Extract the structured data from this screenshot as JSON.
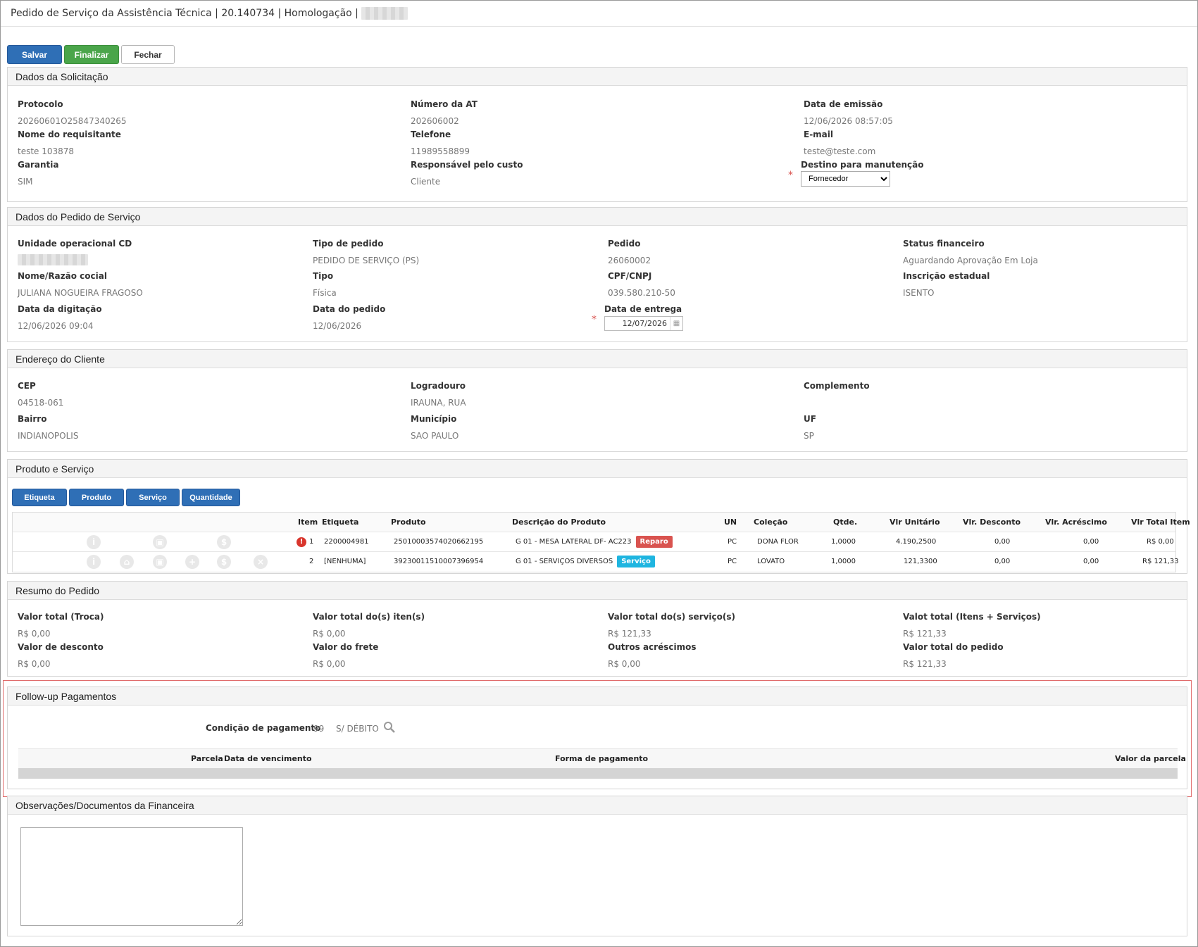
{
  "window": {
    "title": "Pedido de Serviço da Assistência Técnica | 20.140734 | Homologação |"
  },
  "toolbar": {
    "save": "Salvar",
    "finish": "Finalizar",
    "close": "Fechar"
  },
  "solicitacao": {
    "title": "Dados da Solicitação",
    "protocolo_label": "Protocolo",
    "protocolo": "20260601O25847340265",
    "numero_at_label": "Número da AT",
    "numero_at": "202606002",
    "data_emissao_label": "Data de emissão",
    "data_emissao": "12/06/2026 08:57:05",
    "requisitante_label": "Nome do requisitante",
    "requisitante": "teste 103878",
    "telefone_label": "Telefone",
    "telefone": "11989558899",
    "email_label": "E-mail",
    "email": "teste@teste.com",
    "garantia_label": "Garantia",
    "garantia": "SIM",
    "responsavel_label": "Responsável pelo custo",
    "responsavel": "Cliente",
    "destino_label": "Destino para manutenção",
    "destino": "Fornecedor"
  },
  "pedido": {
    "title": "Dados do Pedido de Serviço",
    "unidade_label": "Unidade operacional CD",
    "tipo_pedido_label": "Tipo de pedido",
    "tipo_pedido": "PEDIDO DE SERVIÇO (PS)",
    "pedido_label": "Pedido",
    "pedido": "26060002",
    "status_label": "Status financeiro",
    "status": "Aguardando Aprovação Em Loja",
    "nome_label": "Nome/Razão cocial",
    "nome": "JULIANA NOGUEIRA FRAGOSO",
    "tipo_label": "Tipo",
    "tipo": "Física",
    "cpf_label": "CPF/CNPJ",
    "cpf": "039.580.210-50",
    "ie_label": "Inscrição estadual",
    "ie": "ISENTO",
    "digitacao_label": "Data da digitação",
    "digitacao": "12/06/2026 09:04",
    "data_pedido_label": "Data do pedido",
    "data_pedido": "12/06/2026",
    "entrega_label": "Data de entrega",
    "entrega": "12/07/2026"
  },
  "endereco": {
    "title": "Endereço do Cliente",
    "cep_label": "CEP",
    "cep": "04518-061",
    "logradouro_label": "Logradouro",
    "logradouro": "IRAUNA, RUA",
    "complemento_label": "Complemento",
    "bairro_label": "Bairro",
    "bairro": "INDIANOPOLIS",
    "municipio_label": "Município",
    "municipio": "SAO PAULO",
    "uf_label": "UF",
    "uf": "SP"
  },
  "produtos": {
    "title": "Produto e Serviço",
    "buttons": [
      "Etiqueta",
      "Produto",
      "Serviço",
      "Quantidade"
    ],
    "columns": {
      "item": "Item",
      "etiqueta": "Etiqueta",
      "produto": "Produto",
      "descricao": "Descrição do Produto",
      "un": "UN",
      "colecao": "Coleção",
      "qtde": "Qtde.",
      "unitario": "Vlr Unitário",
      "desconto": "Vlr. Desconto",
      "acrescimo": "Vlr. Acréscimo",
      "total": "Vlr Total Item"
    },
    "rows": [
      {
        "item": "1",
        "etiqueta": "2200004981",
        "produto": "25010003574020662195",
        "descricao": "G 01 - MESA LATERAL DF- AC223",
        "badge": "Reparo",
        "un": "PC",
        "colecao": "DONA FLOR",
        "qtde": "1,0000",
        "unitario": "4.190,2500",
        "desconto": "0,00",
        "acrescimo": "0,00",
        "total": "R$ 0,00"
      },
      {
        "item": "2",
        "etiqueta": "[NENHUMA]",
        "produto": "39230011510007396954",
        "descricao": "G 01 - SERVIÇOS DIVERSOS",
        "badge": "Serviço",
        "un": "PC",
        "colecao": "LOVATO",
        "qtde": "1,0000",
        "unitario": "121,3300",
        "desconto": "0,00",
        "acrescimo": "0,00",
        "total": "R$ 121,33"
      }
    ],
    "badge_colors": {
      "Reparo": "#d9534f",
      "Serviço": "#1fb5e0"
    }
  },
  "resumo": {
    "title": "Resumo do Pedido",
    "troca_label": "Valor total (Troca)",
    "troca": "R$ 0,00",
    "itens_label": "Valor total do(s) iten(s)",
    "itens": "R$ 0,00",
    "servicos_label": "Valor total do(s) serviço(s)",
    "servicos": "R$ 121,33",
    "itens_servicos_label": "Valot total (Itens + Serviços)",
    "itens_servicos": "R$ 121,33",
    "desconto_label": "Valor de desconto",
    "desconto": "R$ 0,00",
    "frete_label": "Valor do frete",
    "frete": "R$ 0,00",
    "acrescimos_label": "Outros acréscimos",
    "acrescimos": "R$ 0,00",
    "total_label": "Valor total do pedido",
    "total": "R$ 121,33"
  },
  "followup": {
    "title": "Follow-up Pagamentos",
    "condicao_label": "Condição de pagamento",
    "condicao_code": "99",
    "condicao_desc": "S/ DÉBITO",
    "columns": {
      "parcela": "Parcela",
      "vencimento": "Data de vencimento",
      "forma": "Forma de pagamento",
      "valor": "Valor da parcela"
    }
  },
  "observacoes": {
    "title": "Observações/Documentos da Financeira"
  },
  "colors": {
    "primary": "#2f6fb6",
    "success": "#4aa54a",
    "danger": "#d9534f",
    "info": "#1fb5e0"
  }
}
